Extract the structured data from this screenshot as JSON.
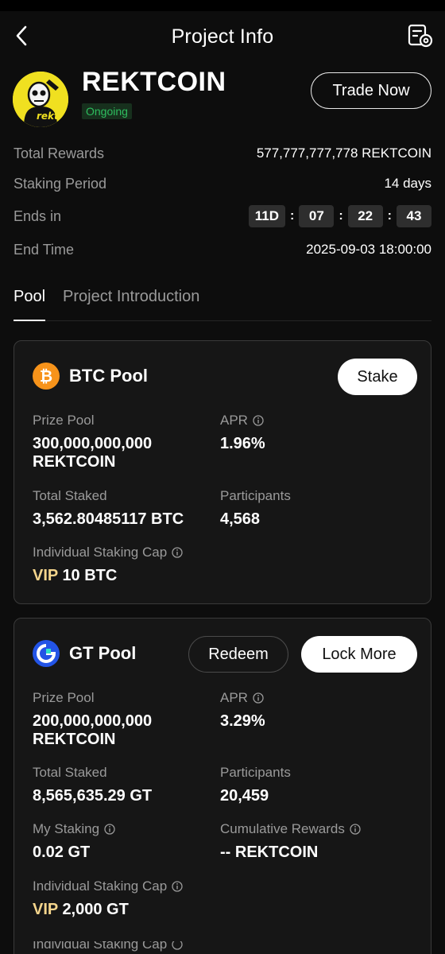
{
  "header": {
    "title": "Project Info"
  },
  "project": {
    "name": "REKTCOIN",
    "status": "Ongoing",
    "trade_button": "Trade Now",
    "logo_text": "rekt"
  },
  "info": {
    "total_rewards_label": "Total Rewards",
    "total_rewards_value": "577,777,777,778 REKTCOIN",
    "staking_period_label": "Staking Period",
    "staking_period_value": "14 days",
    "ends_in_label": "Ends in",
    "countdown": {
      "days": "11D",
      "hours": "07",
      "minutes": "22",
      "seconds": "43",
      "sep": ":"
    },
    "end_time_label": "End Time",
    "end_time_value": "2025-09-03 18:00:00"
  },
  "tabs": [
    "Pool",
    "Project Introduction"
  ],
  "btc_pool": {
    "name": "BTC Pool",
    "stake_button": "Stake",
    "prize_pool_label": "Prize Pool",
    "prize_pool_value_1": "300,000,000,000",
    "prize_pool_value_2": "REKTCOIN",
    "apr_label": "APR",
    "apr_value": "1.96%",
    "total_staked_label": "Total Staked",
    "total_staked_value": "3,562.80485117 BTC",
    "participants_label": "Participants",
    "participants_value": "4,568",
    "cap_label": "Individual Staking Cap",
    "cap_vip": "VIP",
    "cap_value": "10 BTC"
  },
  "gt_pool": {
    "name": "GT Pool",
    "redeem_button": "Redeem",
    "lock_more_button": "Lock More",
    "prize_pool_label": "Prize Pool",
    "prize_pool_value_1": "200,000,000,000",
    "prize_pool_value_2": "REKTCOIN",
    "apr_label": "APR",
    "apr_value": "3.29%",
    "total_staked_label": "Total Staked",
    "total_staked_value": "8,565,635.29 GT",
    "participants_label": "Participants",
    "participants_value": "20,459",
    "my_staking_label": "My Staking",
    "my_staking_value": "0.02 GT",
    "cumulative_label": "Cumulative Rewards",
    "cumulative_value": "-- REKTCOIN",
    "cap_label": "Individual Staking Cap",
    "cap_vip": "VIP",
    "cap_value": "2,000 GT"
  },
  "partial_next": {
    "cap_label": "Individual Staking Cap"
  }
}
